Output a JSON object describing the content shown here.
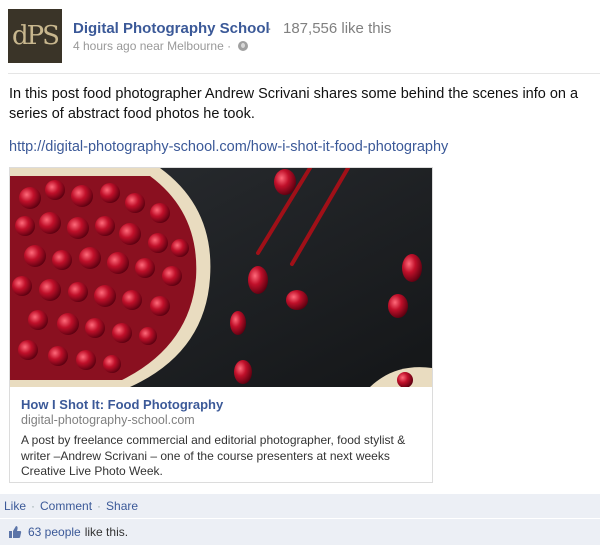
{
  "post": {
    "logo_text": "dPS",
    "page_name": "Digital Photography School",
    "separator": "·",
    "like_count": "187,556 like this",
    "timestamp": "4 hours ago near Melbourne ·",
    "body": "In this post food photographer Andrew Scrivani shares some behind the scenes info on a series of abstract food photos he took.",
    "url": "http://digital-photography-school.com/how-i-shot-it-food-photography"
  },
  "attachment": {
    "title": "How I Shot It: Food Photography",
    "domain": "digital-photography-school.com",
    "description": "A post by freelance commercial and editorial photographer, food stylist & writer –Andrew Scrivani – one of the course presenters at next weeks Creative Live Photo Week."
  },
  "actions": {
    "like": "Like",
    "comment": "Comment",
    "share": "Share",
    "dot": "·"
  },
  "likes_summary": {
    "people": "63 people",
    "rest": "like this."
  },
  "icons": {
    "privacy": "globe-icon",
    "like": "thumbs-up-icon"
  },
  "colors": {
    "link": "#3b5998",
    "action_bar": "#eceff5"
  }
}
